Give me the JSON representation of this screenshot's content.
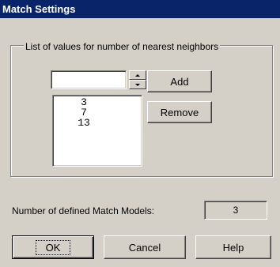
{
  "window": {
    "title": "Match Settings"
  },
  "neighbors_group": {
    "legend": "List of values for number of nearest neighbors",
    "input_value": "",
    "add_label": "Add",
    "remove_label": "Remove",
    "values": [
      "3",
      "7",
      "13"
    ]
  },
  "models": {
    "label": "Number of defined Match Models:",
    "count": "3"
  },
  "footer": {
    "ok_label": "OK",
    "cancel_label": "Cancel",
    "help_label": "Help"
  }
}
